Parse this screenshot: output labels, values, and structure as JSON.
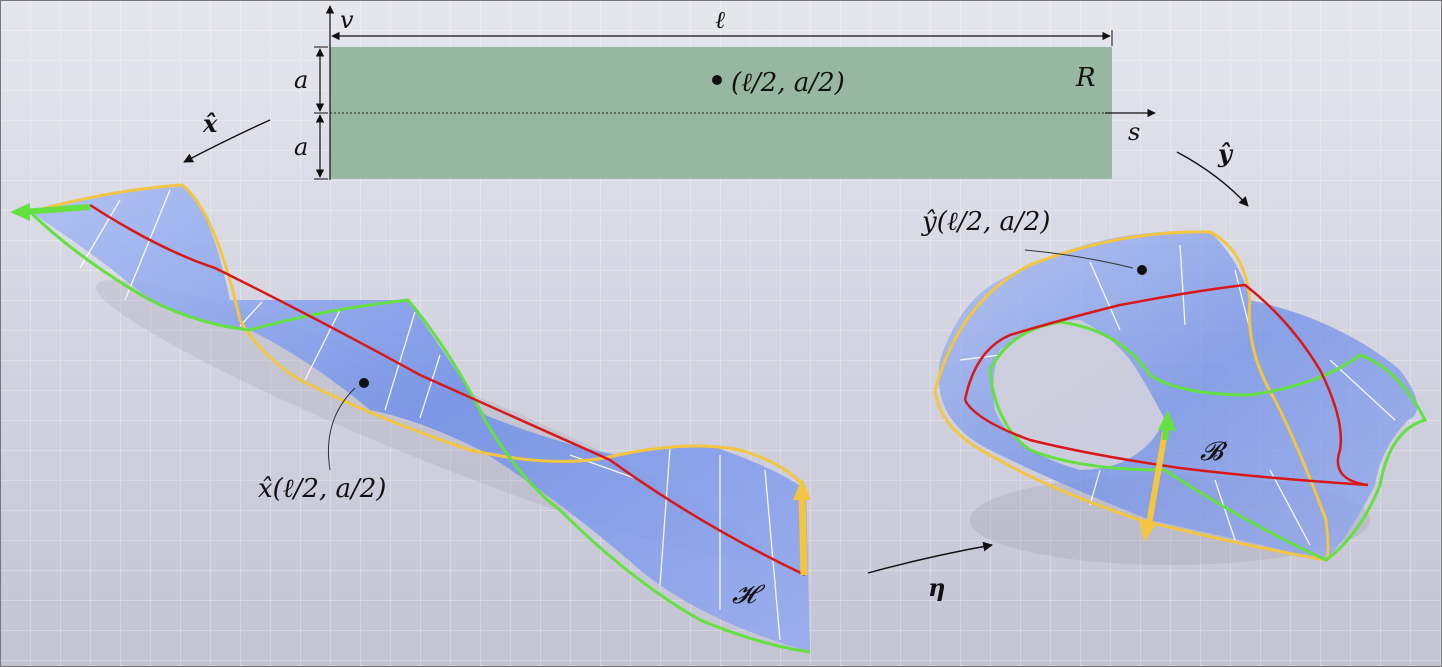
{
  "rect": {
    "ell_label": "ℓ",
    "v_label": "v",
    "s_label": "s",
    "a_top_label": "a",
    "a_bottom_label": "a",
    "region_label": "R",
    "point_label": "(ℓ/2, a/2)"
  },
  "maps": {
    "x_hat_label": "x̂",
    "y_hat_label": "ŷ",
    "eta_label": "η"
  },
  "helix": {
    "point_label": "x̂(ℓ/2, a/2)",
    "name_label": "𝓗"
  },
  "band": {
    "point_label": "ŷ(ℓ/2, a/2)",
    "name_label": "𝓑"
  },
  "colors": {
    "rect_fill": "#8fb39a",
    "surface": "#6f8fe8",
    "centerline": "#d81818",
    "edge_green": "#64e040",
    "edge_yellow": "#f2c640",
    "background": "#c9c9d8"
  }
}
